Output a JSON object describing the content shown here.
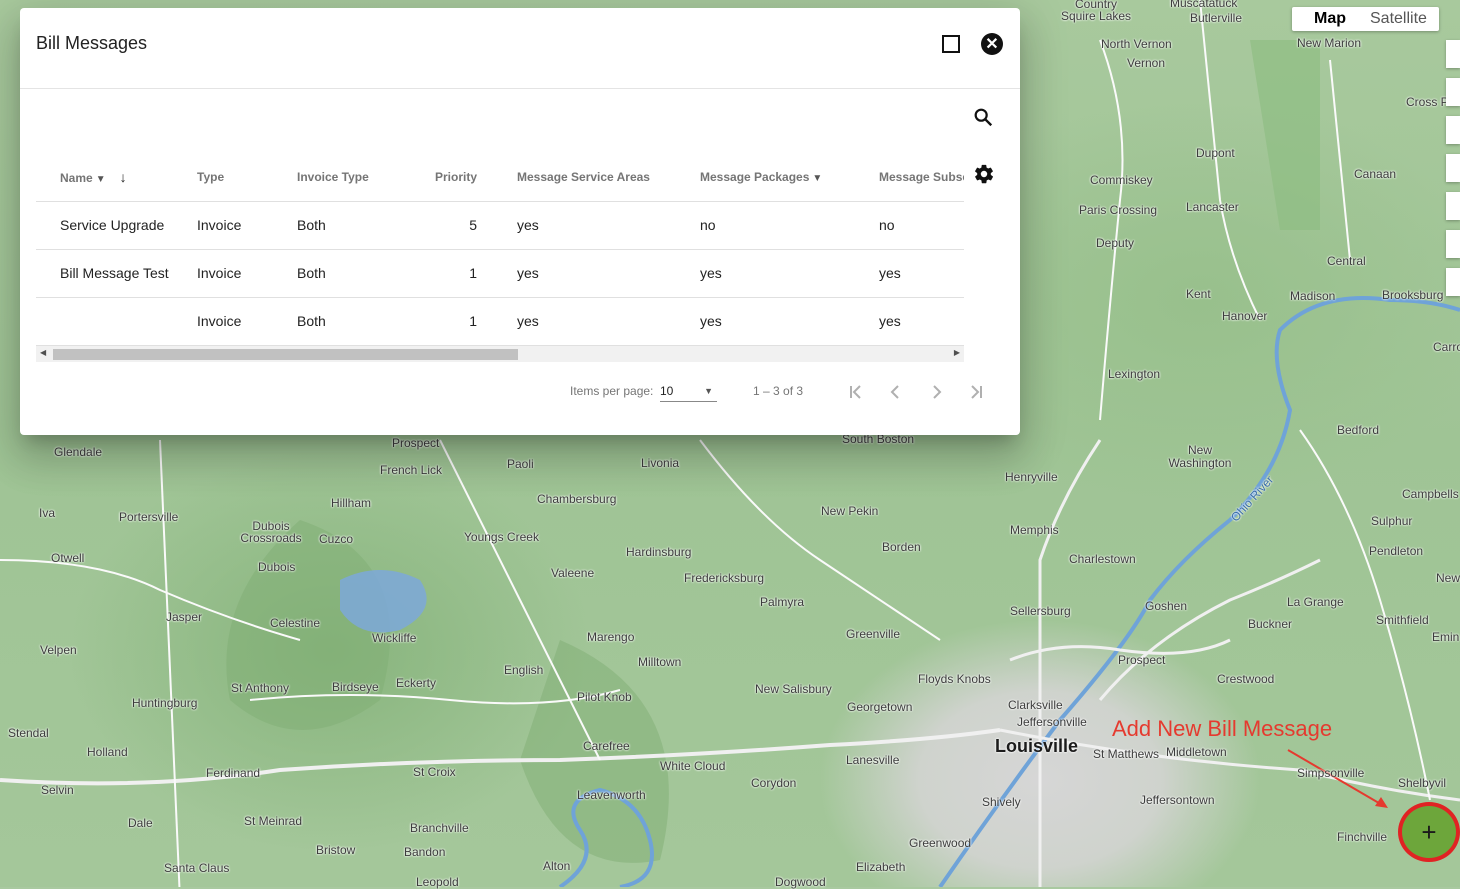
{
  "dialog": {
    "title": "Bill Messages",
    "maximize_icon": "maximize-icon",
    "close_icon": "close-icon",
    "search_icon": "search-icon",
    "settings_icon": "gear-icon"
  },
  "table": {
    "headers": {
      "name": "Name",
      "type": "Type",
      "invoice_type": "Invoice Type",
      "priority": "Priority",
      "areas": "Message Service Areas",
      "packages": "Message Packages",
      "subsc": "Message Subsc"
    },
    "rows": [
      {
        "name": "Service Upgrade",
        "type": "Invoice",
        "invoice_type": "Both",
        "priority": "5",
        "areas": "yes",
        "packages": "no",
        "subsc": "no"
      },
      {
        "name": "Bill Message Test",
        "type": "Invoice",
        "invoice_type": "Both",
        "priority": "1",
        "areas": "yes",
        "packages": "yes",
        "subsc": "yes"
      },
      {
        "name": "",
        "type": "Invoice",
        "invoice_type": "Both",
        "priority": "1",
        "areas": "yes",
        "packages": "yes",
        "subsc": "yes"
      }
    ]
  },
  "paginator": {
    "items_per_page_label": "Items per page:",
    "items_per_page": "10",
    "range": "1 – 3 of 3"
  },
  "map": {
    "type_options": [
      "Map",
      "Satellite"
    ],
    "labels": [
      "Country",
      "Squire Lakes",
      "Muscatatuck",
      "Butlerville",
      "New Marion",
      "North Vernon",
      "Vernon",
      "Cross P",
      "Dupont",
      "Commiskey",
      "Canaan",
      "Paris Crossing",
      "Lancaster",
      "Deputy",
      "Central",
      "Madison",
      "Brooksburg",
      "Kent",
      "Hanover",
      "Lexington",
      "Bedford",
      "Glendale",
      "Prospect",
      "French Lick",
      "Paoli",
      "Livonia",
      "South Boston",
      "New Washington",
      "Hillham",
      "Chambersburg",
      "Henryville",
      "Campbells",
      "Iva",
      "Portersville",
      "New Pekin",
      "Dubois Crossroads",
      "Cuzco",
      "Youngs Creek",
      "Memphis",
      "Sulphur",
      "Otwell",
      "Dubois",
      "Hardinsburg",
      "Borden",
      "Charlestown",
      "Pendleton",
      "Valeene",
      "Fredericksburg",
      "Palmyra",
      "Jasper",
      "Celestine",
      "Goshen",
      "La Grange",
      "Sellersburg",
      "Smithfield",
      "Velpen",
      "Wickliffe",
      "Marengo",
      "Greenville",
      "Buckner",
      "Milltown",
      "English",
      "Prospect",
      "Floyds Knobs",
      "Crestwood",
      "St Anthony",
      "Birdseye",
      "Eckerty",
      "Huntingburg",
      "Pilot Knob",
      "New Salisbury",
      "Georgetown",
      "Clarksville",
      "Jeffersonville",
      "Stendal",
      "Louisville",
      "St Matthews",
      "Middletown",
      "Holland",
      "Carefree",
      "White Cloud",
      "Lanesville",
      "Simpsonville",
      "Ferdinand",
      "St Croix",
      "Corydon",
      "Selvin",
      "Leavenworth",
      "Shively",
      "Jeffersontown",
      "Shelbyvil",
      "Dale",
      "St Meinrad",
      "Branchville",
      "Finchville",
      "Bristow",
      "Bandon",
      "Greenwood",
      "Santa Claus",
      "Alton",
      "Elizabeth",
      "Leopold",
      "Dogwood",
      "Ohio River",
      "Emin",
      "New",
      "Carro"
    ],
    "annotation": "Add New Bill Message",
    "fab_icon": "plus-icon",
    "fab_label": "+"
  }
}
